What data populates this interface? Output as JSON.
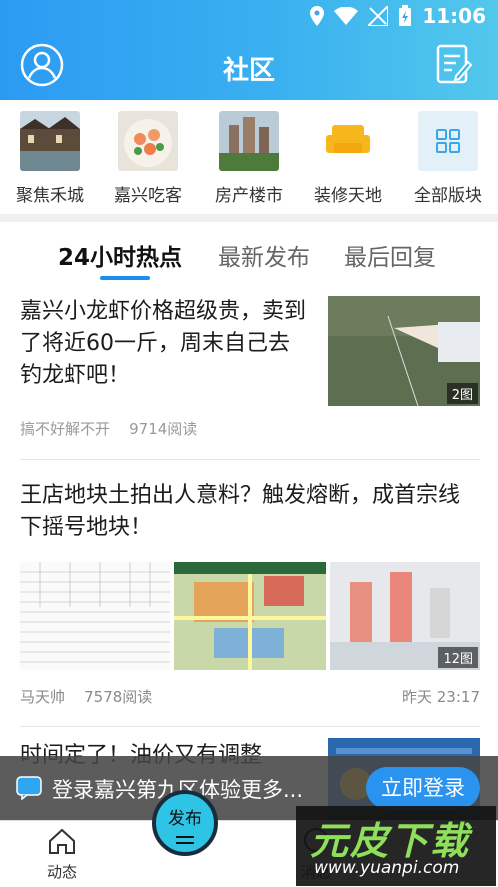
{
  "status_bar": {
    "time": "11:06"
  },
  "header": {
    "title": "社区"
  },
  "quick_nav": [
    {
      "label": "聚焦禾城"
    },
    {
      "label": "嘉兴吃客"
    },
    {
      "label": "房产楼市"
    },
    {
      "label": "装修天地"
    },
    {
      "label": "全部版块"
    }
  ],
  "tabs": [
    {
      "label": "24小时热点",
      "active": true
    },
    {
      "label": "最新发布"
    },
    {
      "label": "最后回复"
    }
  ],
  "posts": [
    {
      "title": "嘉兴小龙虾价格超级贵，卖到了将近60一斤，周末自己去钓龙虾吧！",
      "author": "搞不好解不开",
      "reads": "9714阅读",
      "image_count": "2图"
    },
    {
      "title": "王店地块土拍出人意料？触发熔断，成首宗线下摇号地块！",
      "author": "马天帅",
      "reads": "7578阅读",
      "time": "昨天 23:17",
      "image_count": "12图"
    },
    {
      "title": "时间定了！油价又有调整"
    }
  ],
  "login_bar": {
    "text": "登录嘉兴第九区体验更多...",
    "button": "立即登录"
  },
  "bottom_nav": {
    "home": "动态",
    "publish": "发布",
    "messages": "消息"
  },
  "watermark": {
    "brand": "元皮下载",
    "url": "www.yuanpi.com"
  },
  "colors": {
    "accent": "#2a93ef",
    "header_start": "#2b9bf2",
    "header_end": "#52c8ec"
  }
}
